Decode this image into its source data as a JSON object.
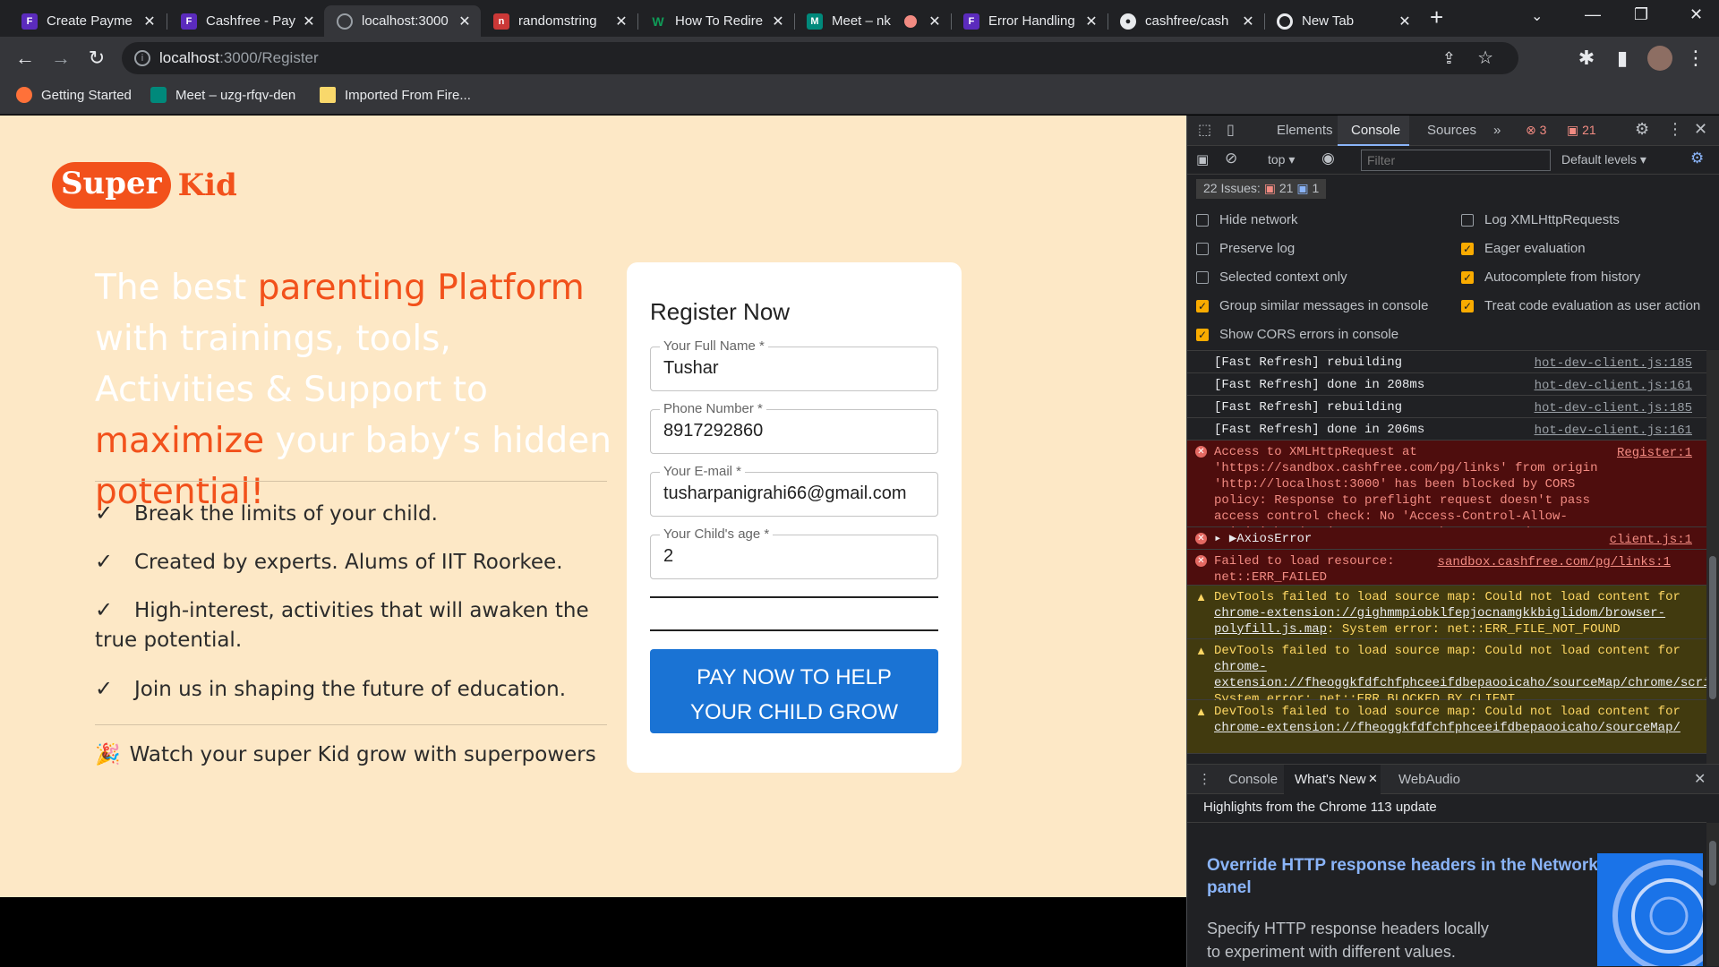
{
  "tabs": [
    {
      "title": "Create Payme",
      "fav": "F",
      "color": "#5b2bbd"
    },
    {
      "title": "Cashfree - Pay",
      "fav": "F",
      "color": "#5b2bbd"
    },
    {
      "title": "localhost:3000",
      "fav": "globe",
      "color": "#9aa0a6"
    },
    {
      "title": "randomstring",
      "fav": "n",
      "color": "#cb3837"
    },
    {
      "title": "How To Redire",
      "fav": "W",
      "color": "#0f9d58"
    },
    {
      "title": "Meet – nk",
      "fav": "M",
      "color": "#00897b"
    },
    {
      "title": "Error Handling",
      "fav": "F",
      "color": "#5b2bbd"
    },
    {
      "title": "cashfree/cash",
      "fav": "gh",
      "color": "#e8eaed"
    },
    {
      "title": "New Tab",
      "fav": "chrome",
      "color": "#e8eaed"
    }
  ],
  "address": {
    "host": "localhost",
    "path": ":3000/Register"
  },
  "bookmarks": [
    {
      "label": "Getting Started",
      "color": "#ff7139"
    },
    {
      "label": "Meet – uzg-rfqv-den",
      "color": "#00897b"
    },
    {
      "label": "Imported From Fire...",
      "color": "#f9d86b"
    }
  ],
  "logo": {
    "super": "Super",
    "kid": "Kid"
  },
  "hero": {
    "p1": "The best ",
    "p2": "parenting Platform",
    "p3": " with trainings, tools, Activities & Support to ",
    "p4": "maximize",
    "p5": " your baby’s hidden ",
    "p6": "potential!"
  },
  "features": [
    "Break the limits of your child.",
    "Created by experts. Alums of IIT Roorkee.",
    "High-interest, activities that will awaken the true potential.",
    "Join us in shaping the future of education."
  ],
  "watch": "Watch your super Kid grow with superpowers",
  "form": {
    "title": "Register Now",
    "fields": [
      {
        "label": "Your Full Name *",
        "value": "Tushar"
      },
      {
        "label": "Phone Number *",
        "value": "8917292860"
      },
      {
        "label": "Your E-mail *",
        "value": "tusharpanigrahi66@gmail.com"
      },
      {
        "label": "Your Child's age *",
        "value": "2"
      }
    ],
    "pay_line1": "PAY NOW TO HELP",
    "pay_line2": "YOUR CHILD GROW"
  },
  "devtools": {
    "tabs": [
      "Elements",
      "Console",
      "Sources"
    ],
    "err_count": "3",
    "warn_count": "21",
    "context": "top",
    "filter_placeholder": "Filter",
    "levels": "Default levels",
    "issues": "22 Issues:",
    "issues_a": "21",
    "issues_b": "1",
    "options_left": [
      "Hide network",
      "Preserve log",
      "Selected context only",
      "Group similar messages in console",
      "Show CORS errors in console"
    ],
    "options_right": [
      "Log XMLHttpRequests",
      "Eager evaluation",
      "Autocomplete from history",
      "Treat code evaluation as user action"
    ],
    "logs": [
      {
        "text": "[Fast Refresh] rebuilding",
        "src": "hot-dev-client.js:185"
      },
      {
        "text": "[Fast Refresh] done in 208ms",
        "src": "hot-dev-client.js:161"
      },
      {
        "text": "[Fast Refresh] rebuilding",
        "src": "hot-dev-client.js:185"
      },
      {
        "text": "[Fast Refresh] done in 206ms",
        "src": "hot-dev-client.js:161"
      }
    ],
    "cors_error": "Access to XMLHttpRequest at 'https://sandbox.cashfree.com/pg/links' from origin 'http://localhost:3000' has been blocked by CORS policy: Response to preflight request doesn't pass access control check: No 'Access-Control-Allow-Origin' header is present on the requested resource.",
    "cors_src": "Register:1",
    "axios": "▸ ▶AxiosError",
    "axios_src": "client.js:1",
    "failed": "Failed to load resource: net::ERR_FAILED",
    "failed_src": "sandbox.cashfree.com/pg/links:1",
    "warn1_a": "DevTools failed to load source map: Could not load content for ",
    "warn1_u": "chrome-extension://gighmmpiobklfepjocnamgkkbiglidom/browser-polyfill.js.map",
    "warn1_b": ": System error: net::ERR_FILE_NOT_FOUND",
    "warn2_a": "DevTools failed to load source map: Could not load content for ",
    "warn2_u": "chrome-extension://fheoggkfdfchfphceeifdbepaooicaho/sourceMap/chrome/scripts/iframe_form_check.js.map",
    "warn2_b": ": System error: net::ERR_BLOCKED_BY_CLIENT",
    "warn3_a": "DevTools failed to load source map: Could not load content for ",
    "warn3_u": "chrome-extension://fheoggkfdfchfphceeifdbepaooicaho/sourceMap/",
    "drawer_tabs": [
      "Console",
      "What's New",
      "WebAudio"
    ],
    "whatsnew_head": "Highlights from the Chrome 113 update",
    "whatsnew_title": "Override HTTP response headers in the Network panel",
    "whatsnew_body": "Specify HTTP response headers locally to experiment with different values."
  }
}
